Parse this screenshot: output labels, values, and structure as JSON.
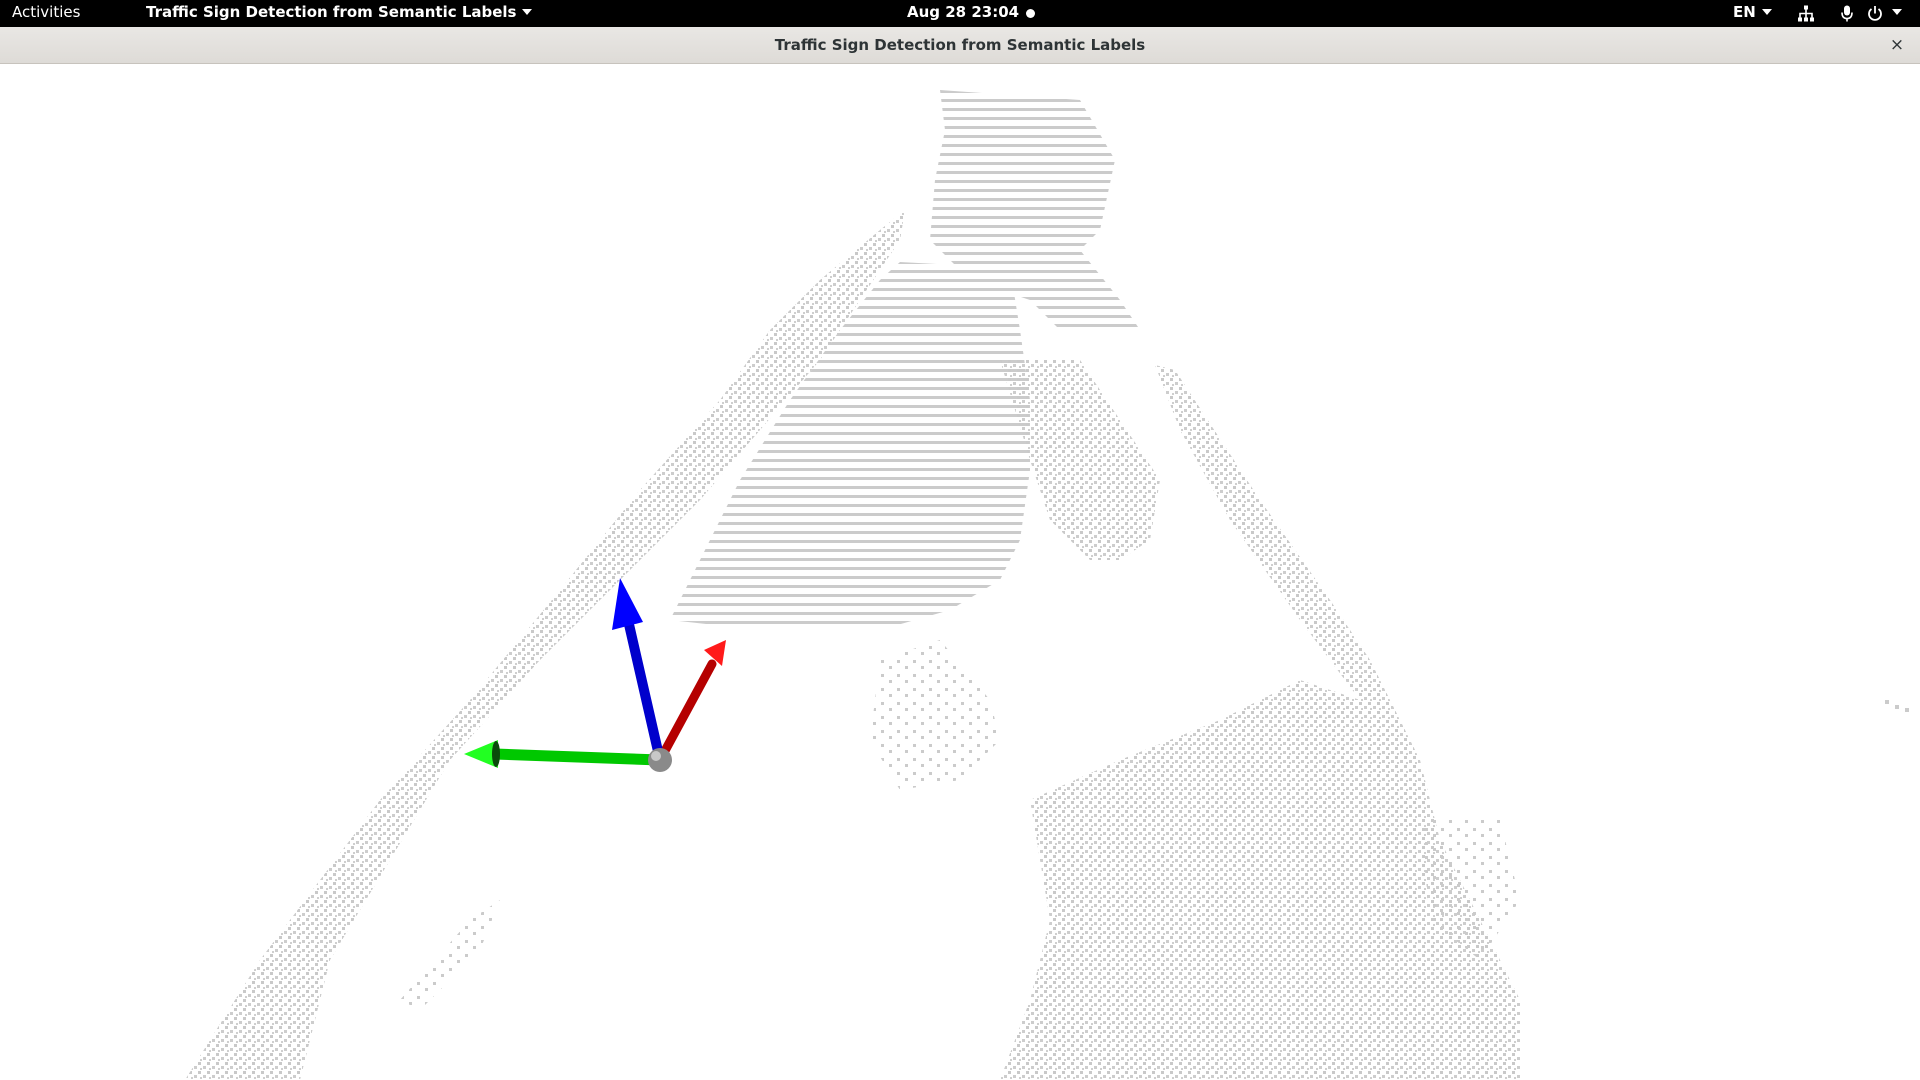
{
  "topbar": {
    "activities_label": "Activities",
    "app_menu_label": "Traffic Sign Detection from Semantic Labels",
    "clock_text": "Aug 28  23:04",
    "language_label": "EN"
  },
  "window": {
    "title": "Traffic Sign Detection from Semantic Labels",
    "close_glyph": "×"
  },
  "viewer": {
    "point_color": "#cbcbcb",
    "axis_colors": {
      "x": "#d40000",
      "y": "#00dd00",
      "z": "#0000ee",
      "origin": "#8a8a8a"
    }
  },
  "icons": [
    "network-icon",
    "microphone-icon",
    "power-icon"
  ]
}
